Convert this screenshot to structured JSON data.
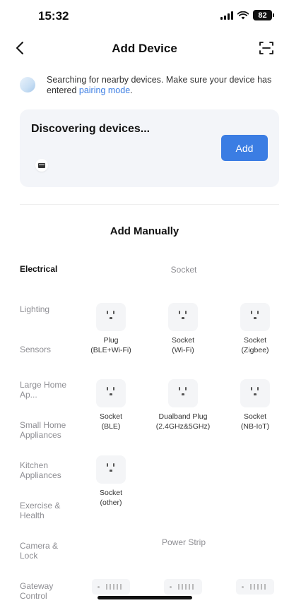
{
  "status_bar": {
    "time": "15:32",
    "battery": "82"
  },
  "nav": {
    "title": "Add Device",
    "back_icon": "chevron-left-icon",
    "scan_icon": "scan-icon"
  },
  "search": {
    "message": "Searching for nearby devices. Make sure your device has entered ",
    "link": "pairing mode",
    "suffix": "."
  },
  "discover": {
    "title": "Discovering devices...",
    "add_label": "Add"
  },
  "manual": {
    "title": "Add Manually"
  },
  "categories": [
    {
      "label": "Electrical",
      "active": true
    },
    {
      "label": "Lighting"
    },
    {
      "label": "Sensors"
    },
    {
      "label": "Large Home Ap..."
    },
    {
      "label": "Small Home Appliances"
    },
    {
      "label": "Kitchen Appliances"
    },
    {
      "label": "Exercise & Health"
    },
    {
      "label": "Camera & Lock"
    },
    {
      "label": "Gateway Control"
    }
  ],
  "sections": {
    "socket": "Socket",
    "power_strip": "Power Strip"
  },
  "socket_devices": [
    {
      "line1": "Plug",
      "line2": "(BLE+Wi-Fi)"
    },
    {
      "line1": "Socket",
      "line2": "(Wi-Fi)"
    },
    {
      "line1": "Socket",
      "line2": "(Zigbee)"
    },
    {
      "line1": "Socket",
      "line2": "(BLE)"
    },
    {
      "line1": "Dualband Plug",
      "line2": "(2.4GHz&5GHz)"
    },
    {
      "line1": "Socket",
      "line2": "(NB-IoT)"
    },
    {
      "line1": "Socket",
      "line2": "(other)"
    }
  ],
  "colors": {
    "accent": "#3b7de3",
    "card_bg": "#f3f5f9",
    "muted_text": "#8e8e93"
  }
}
